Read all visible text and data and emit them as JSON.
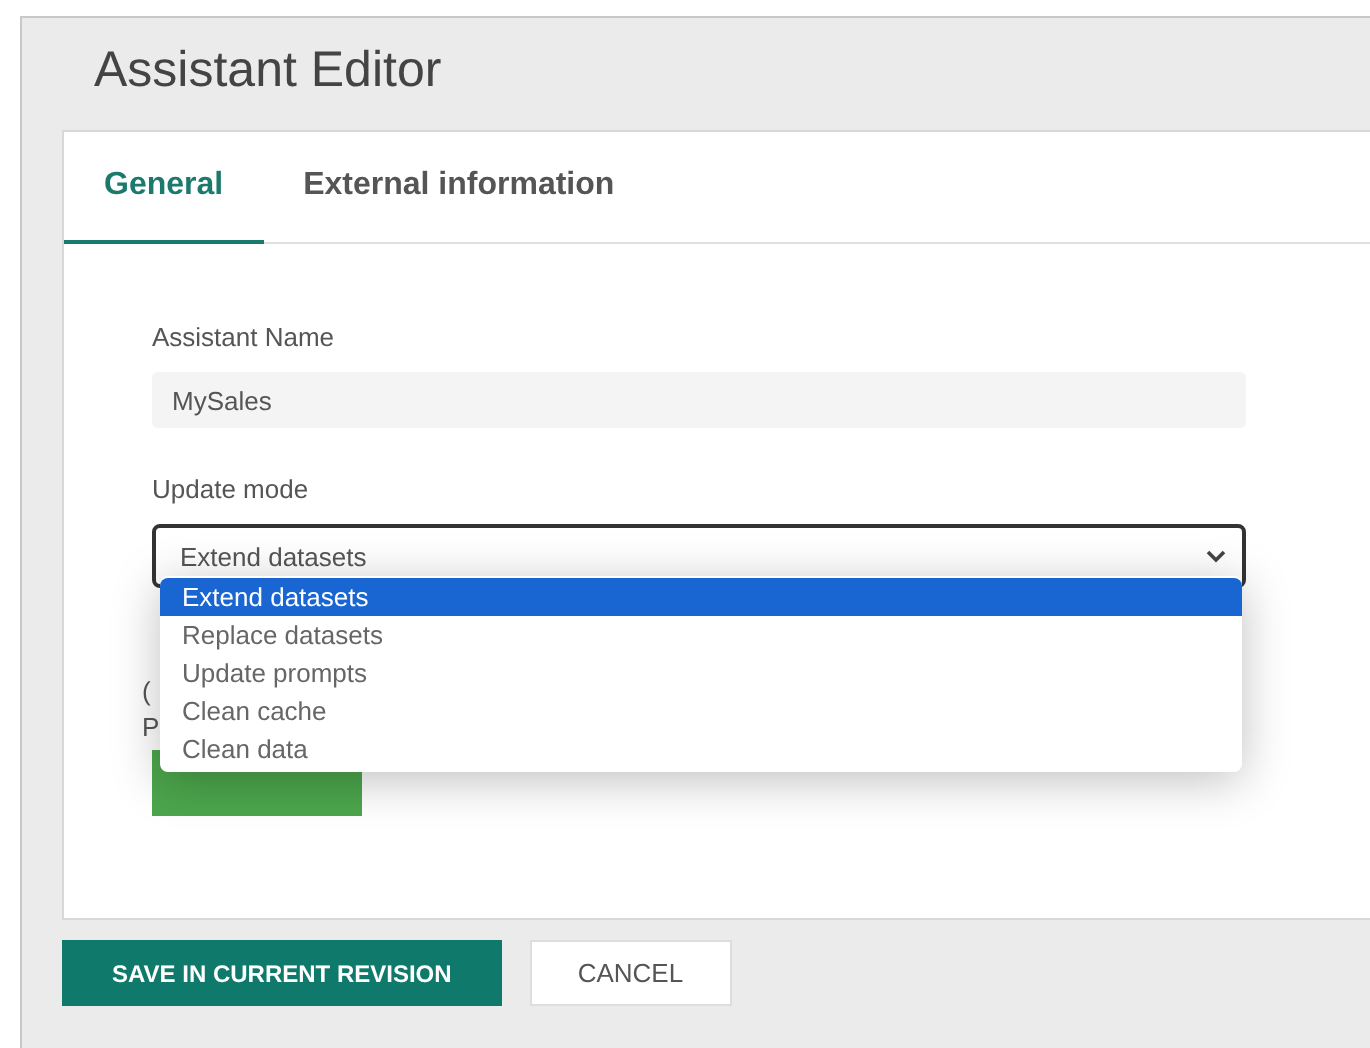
{
  "window": {
    "title": "Assistant Editor"
  },
  "tabs": [
    {
      "label": "General",
      "selected": true
    },
    {
      "label": "External information",
      "selected": false
    }
  ],
  "form": {
    "name_label": "Assistant Name",
    "name_value": "MySales",
    "mode_label": "Update mode",
    "mode_value": "Extend datasets",
    "options": [
      {
        "label": "Extend datasets",
        "selected": true
      },
      {
        "label": "Replace datasets",
        "selected": false
      },
      {
        "label": "Update prompts",
        "selected": false
      },
      {
        "label": "Clean cache",
        "selected": false
      },
      {
        "label": "Clean data",
        "selected": false
      }
    ],
    "hidden_line_1": "(",
    "hidden_line_2": "P"
  },
  "buttons": [
    {
      "label": "SAVE IN CURRENT REVISION",
      "kind": "primary"
    },
    {
      "label": "CANCEL",
      "kind": "secondary"
    }
  ]
}
